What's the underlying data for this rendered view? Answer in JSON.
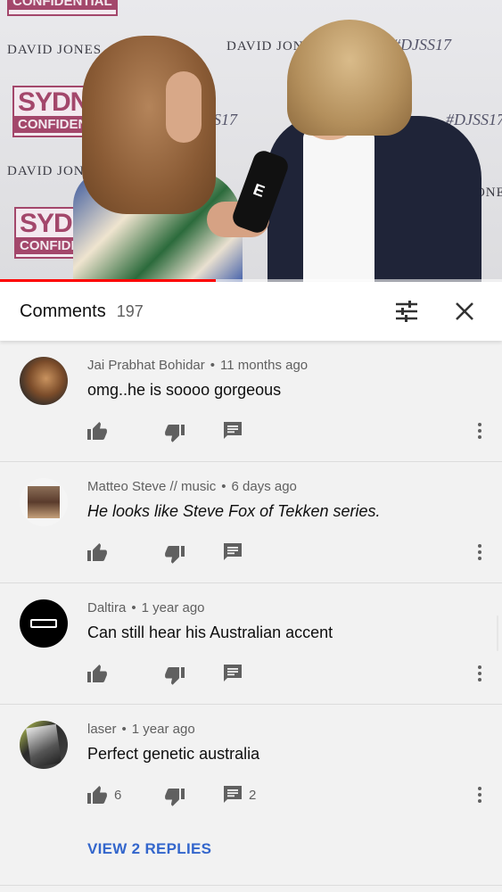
{
  "video": {
    "backdrop": {
      "brand": "DAVID JONES",
      "hashtag": "#DJSS17",
      "logo_line1": "SYDNEY",
      "logo_line2": "CONFIDENTIAL",
      "mic_logo": "E"
    },
    "progress_fraction": 0.43,
    "progress_color": "#ff0000"
  },
  "header": {
    "title": "Comments",
    "count": "197",
    "sort_icon": "tune-sliders-icon",
    "close_icon": "close-icon"
  },
  "comments": [
    {
      "author": "Jai Prabhat Bohidar",
      "time": "11 months ago",
      "text": "omg..he is soooo gorgeous",
      "likes": "",
      "replies": ""
    },
    {
      "author": "Matteo Steve // music",
      "time": "6 days ago",
      "text": "He looks like Steve Fox of Tekken series.",
      "likes": "",
      "replies": ""
    },
    {
      "author": "Daltira",
      "time": "1 year ago",
      "text": "Can still hear his Australian accent",
      "likes": "",
      "replies": ""
    },
    {
      "author": "laser",
      "time": "1 year ago",
      "text": "Perfect genetic australia",
      "likes": "6",
      "replies": "2",
      "view_replies": "VIEW 2 REPLIES"
    }
  ],
  "colors": {
    "accent_link": "#3366cc",
    "icon_gray": "#606060",
    "background": "#f2f2f2"
  },
  "separator": "•"
}
